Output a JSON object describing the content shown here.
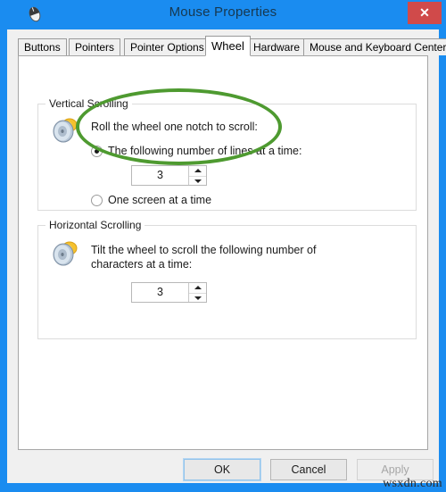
{
  "window": {
    "title": "Mouse Properties",
    "icon": "mouse-icon",
    "close_label": "✕",
    "titlebar_color": "#1a8cf0",
    "close_color": "#d04a4a"
  },
  "tabs": [
    {
      "label": "Buttons",
      "active": false
    },
    {
      "label": "Pointers",
      "active": false
    },
    {
      "label": "Pointer Options",
      "active": false
    },
    {
      "label": "Wheel",
      "active": true
    },
    {
      "label": "Hardware",
      "active": false
    },
    {
      "label": "Mouse and Keyboard Center",
      "active": false
    }
  ],
  "vertical_scrolling": {
    "group_title": "Vertical Scrolling",
    "icon": "mouse-wheel-icon",
    "description": "Roll the wheel one notch to scroll:",
    "options": [
      {
        "label": "The following number of lines at a time:",
        "checked": true
      },
      {
        "label": "One screen at a time",
        "checked": false
      }
    ],
    "spinner": {
      "value": "3",
      "up_icon": "arrow-up-icon",
      "down_icon": "arrow-down-icon"
    }
  },
  "horizontal_scrolling": {
    "group_title": "Horizontal Scrolling",
    "icon": "mouse-wheel-icon",
    "description": "Tilt the wheel to scroll the following number of\ncharacters at a time:",
    "spinner": {
      "value": "3",
      "up_icon": "arrow-up-icon",
      "down_icon": "arrow-down-icon"
    }
  },
  "footer": {
    "ok": "OK",
    "cancel": "Cancel",
    "apply": "Apply"
  },
  "annotation": {
    "shape": "ellipse",
    "color": "#4e9a30"
  },
  "watermark": "wsxdn.com"
}
